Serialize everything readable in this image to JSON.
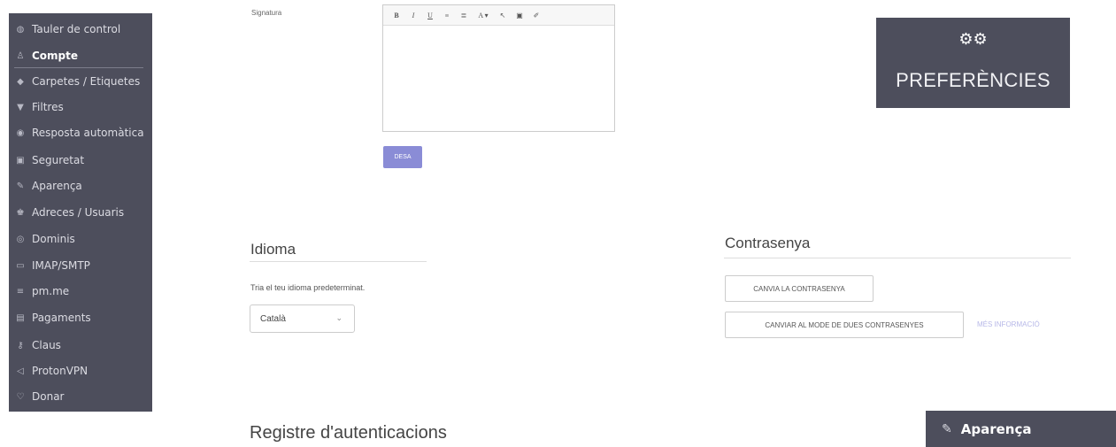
{
  "sidebar": {
    "items": [
      {
        "icon": "dashboard-icon",
        "glyph": "◍",
        "label": "Tauler de control"
      },
      {
        "icon": "user-icon",
        "glyph": "♙",
        "label": "Compte",
        "active": true
      },
      {
        "icon": "tag-icon",
        "glyph": "◆",
        "label": "Carpetes / Etiquetes"
      },
      {
        "icon": "filter-icon",
        "glyph": "▼",
        "label": "Filtres"
      },
      {
        "icon": "auto-reply-icon",
        "glyph": "◉",
        "label": "Resposta automàtica"
      },
      {
        "icon": "lock-icon",
        "glyph": "▣",
        "label": "Seguretat"
      },
      {
        "icon": "paint-brush-icon",
        "glyph": "✎",
        "label": "Aparença"
      },
      {
        "icon": "users-icon",
        "glyph": "♚",
        "label": "Adreces / Usuaris"
      },
      {
        "icon": "globe-icon",
        "glyph": "◎",
        "label": "Dominis"
      },
      {
        "icon": "monitor-icon",
        "glyph": "▭",
        "label": "IMAP/SMTP"
      },
      {
        "icon": "envelope-icon",
        "glyph": "≡",
        "label": "pm.me"
      },
      {
        "icon": "calendar-icon",
        "glyph": "▤",
        "label": "Pagaments"
      },
      {
        "icon": "key-icon",
        "glyph": "⚷",
        "label": "Claus"
      },
      {
        "icon": "vpn-icon",
        "glyph": "◁",
        "label": "ProtonVPN"
      },
      {
        "icon": "heart-icon",
        "glyph": "♡",
        "label": "Donar"
      }
    ]
  },
  "signature": {
    "label": "Signatura",
    "toolbar": [
      "B",
      "I",
      "U",
      "≡",
      "≣",
      "A ▾",
      "↖",
      "▣",
      "✐"
    ],
    "save_label": "DESA"
  },
  "preferences": {
    "icon": "gears-icon",
    "glyph": "⚙⚙",
    "title": "PREFERÈNCIES"
  },
  "language": {
    "title": "Idioma",
    "help": "Tria el teu idioma predeterminat.",
    "selected": "Català",
    "chevron": "⌄"
  },
  "password": {
    "title": "Contrasenya",
    "change_label": "CANVIA LA CONTRASENYA",
    "two_pw_label": "CANVIAR AL MODE DE DUES CONTRASENYES",
    "more_info": "MÉS INFORMACIÓ"
  },
  "auth_log": {
    "title": "Registre d'autenticacions"
  },
  "appearance_badge": {
    "icon": "paint-brush-icon",
    "glyph": "✎",
    "label": "Aparença"
  }
}
